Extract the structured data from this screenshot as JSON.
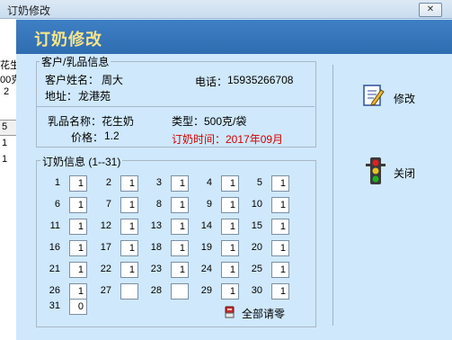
{
  "window": {
    "title": "订奶修改",
    "close_glyph": "✕"
  },
  "background_app": {
    "cells": [
      "花生",
      "00克",
      "2",
      "5",
      "1",
      "1"
    ]
  },
  "header": {
    "title": "订奶修改"
  },
  "customer_group": {
    "legend": "客户/乳品信息",
    "customer_name_label": "客户姓名：",
    "customer_name": "周大",
    "phone_label": "电话：",
    "phone": "15935266708",
    "address_label": "地址：",
    "address": "龙港苑",
    "product_name_label": "乳品名称：",
    "product_name": "花生奶",
    "type_label": "类型：",
    "type": "500克/袋",
    "price_label": "价格：",
    "price": "1.2",
    "order_time_label": "订奶时间：",
    "order_time": "2017年09月"
  },
  "order_group": {
    "legend": "订奶信息 (1--31)",
    "days": [
      {
        "day": "1",
        "qty": "1"
      },
      {
        "day": "2",
        "qty": "1"
      },
      {
        "day": "3",
        "qty": "1"
      },
      {
        "day": "4",
        "qty": "1"
      },
      {
        "day": "5",
        "qty": "1"
      },
      {
        "day": "6",
        "qty": "1"
      },
      {
        "day": "7",
        "qty": "1"
      },
      {
        "day": "8",
        "qty": "1"
      },
      {
        "day": "9",
        "qty": "1"
      },
      {
        "day": "10",
        "qty": "1"
      },
      {
        "day": "11",
        "qty": "1"
      },
      {
        "day": "12",
        "qty": "1"
      },
      {
        "day": "13",
        "qty": "1"
      },
      {
        "day": "14",
        "qty": "1"
      },
      {
        "day": "15",
        "qty": "1"
      },
      {
        "day": "16",
        "qty": "1"
      },
      {
        "day": "17",
        "qty": "1"
      },
      {
        "day": "18",
        "qty": "1"
      },
      {
        "day": "19",
        "qty": "1"
      },
      {
        "day": "20",
        "qty": "1"
      },
      {
        "day": "21",
        "qty": "1"
      },
      {
        "day": "22",
        "qty": "1"
      },
      {
        "day": "23",
        "qty": "1"
      },
      {
        "day": "24",
        "qty": "1"
      },
      {
        "day": "25",
        "qty": "1"
      },
      {
        "day": "26",
        "qty": "1"
      },
      {
        "day": "27",
        "qty": ""
      },
      {
        "day": "28",
        "qty": ""
      },
      {
        "day": "29",
        "qty": "1"
      },
      {
        "day": "30",
        "qty": "1"
      },
      {
        "day": "31",
        "qty": "0"
      }
    ],
    "clear_all_label": "全部请零",
    "clear_all_icon": "eraser-icon"
  },
  "actions": {
    "modify_label": "修改",
    "modify_icon": "edit-document-icon",
    "close_label": "关闭",
    "close_icon": "traffic-light-icon"
  },
  "colors": {
    "header_band": "#2e6db0",
    "header_title": "#f7e58a",
    "order_time": "#d00000",
    "client_bg": "#cfe8fb"
  }
}
